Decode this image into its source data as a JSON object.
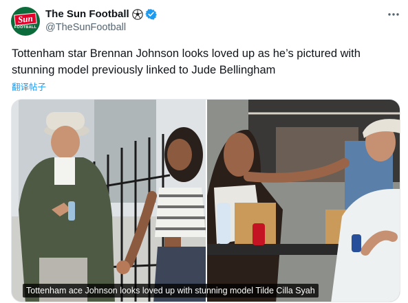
{
  "account": {
    "avatar_brand": "Sun",
    "avatar_sub": "FOOTBALL",
    "display_name": "The Sun Football",
    "handle": "@TheSunFootball",
    "badge_icons": [
      "soccer-ball-icon",
      "verified-badge-icon"
    ]
  },
  "tweet": {
    "text": "Tottenham star Brennan Johnson looks loved up as he’s pictured with stunning model previously linked to Jude Bellingham",
    "translate_label": "翻译帖子"
  },
  "media": {
    "caption": "Tottenham ace Johnson looks loved up with stunning model Tilde Cilla Syah",
    "panels": 2
  },
  "menu": {
    "icon": "more-icon"
  },
  "colors": {
    "link": "#1d9bf0",
    "verified": "#1d9bf0",
    "secondary_text": "#536471",
    "brand_red": "#e4002b",
    "brand_green": "#0b6b3a"
  }
}
